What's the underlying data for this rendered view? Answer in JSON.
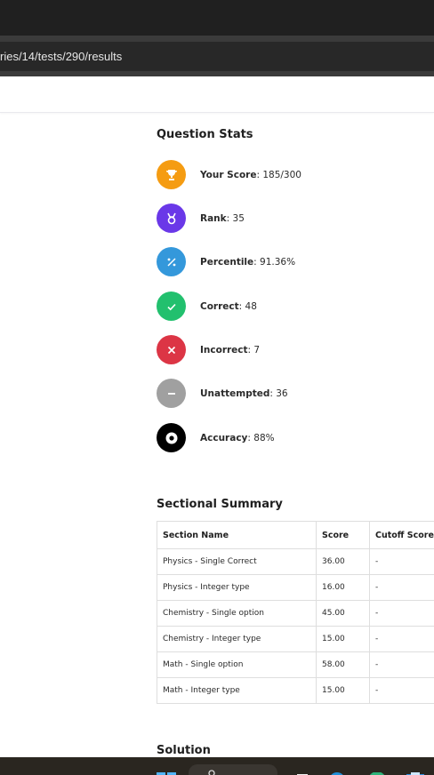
{
  "browser": {
    "url": "ries/14/tests/290/results"
  },
  "question_stats": {
    "title": "Question Stats",
    "items": [
      {
        "label": "Your Score",
        "value": ": 185/300",
        "color": "#f59c12",
        "icon": "trophy-icon"
      },
      {
        "label": "Rank",
        "value": ": 35",
        "color": "#6a38e8",
        "icon": "medal-icon"
      },
      {
        "label": "Percentile",
        "value": ": 91.36%",
        "color": "#3498db",
        "icon": "percent-icon"
      },
      {
        "label": "Correct",
        "value": ": 48",
        "color": "#22c06e",
        "icon": "check-icon"
      },
      {
        "label": "Incorrect",
        "value": ": 7",
        "color": "#dc3545",
        "icon": "cross-icon"
      },
      {
        "label": "Unattempted",
        "value": ": 36",
        "color": "#a0a0a0",
        "icon": "minus-icon"
      },
      {
        "label": "Accuracy",
        "value": ": 88%",
        "color": "#000000",
        "icon": "target-icon"
      }
    ]
  },
  "sectional_summary": {
    "title": "Sectional Summary",
    "headers": [
      "Section Name",
      "Score",
      "Cutoff Score"
    ],
    "rows": [
      [
        "Physics - Single Correct",
        "36.00",
        "-"
      ],
      [
        "Physics - Integer type",
        "16.00",
        "-"
      ],
      [
        "Chemistry - Single option",
        "45.00",
        "-"
      ],
      [
        "Chemistry - Integer type",
        "15.00",
        "-"
      ],
      [
        "Math - Single option",
        "58.00",
        "-"
      ],
      [
        "Math - Integer type",
        "15.00",
        "-"
      ]
    ]
  },
  "solution": {
    "title": "Solution"
  },
  "taskbar": {
    "icons": [
      "windows-start-icon",
      "search-box",
      "file-icon",
      "edge-icon",
      "chrome-icon",
      "store-icon"
    ]
  }
}
